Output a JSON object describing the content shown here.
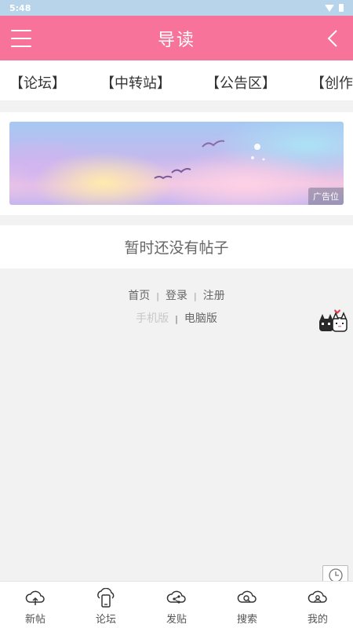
{
  "status_bar": {
    "time": "5:48"
  },
  "header": {
    "title": "导读",
    "menu_icon": "menu-icon",
    "back_icon": "chevron-left-icon"
  },
  "nav": {
    "items": [
      {
        "label": "【论坛】"
      },
      {
        "label": "【中转站】"
      },
      {
        "label": "【公告区】"
      },
      {
        "label": "【创作"
      }
    ]
  },
  "banner": {
    "ad_label": "广告位"
  },
  "posts": {
    "empty_text": "暂时还没有帖子"
  },
  "footer": {
    "home": "首页",
    "login": "登录",
    "register": "注册",
    "separator": "|",
    "mobile": "手机版",
    "desktop": "电脑版"
  },
  "bottom_tabs": [
    {
      "label": "新帖",
      "icon": "cloud-upload-icon"
    },
    {
      "label": "论坛",
      "icon": "cloud-phone-icon"
    },
    {
      "label": "发贴",
      "icon": "cloud-share-icon"
    },
    {
      "label": "搜索",
      "icon": "cloud-search-icon"
    },
    {
      "label": "我的",
      "icon": "cloud-user-icon"
    }
  ],
  "colors": {
    "accent": "#f7739a",
    "status_bar": "#b7d4ea",
    "background": "#f2f2f2"
  }
}
